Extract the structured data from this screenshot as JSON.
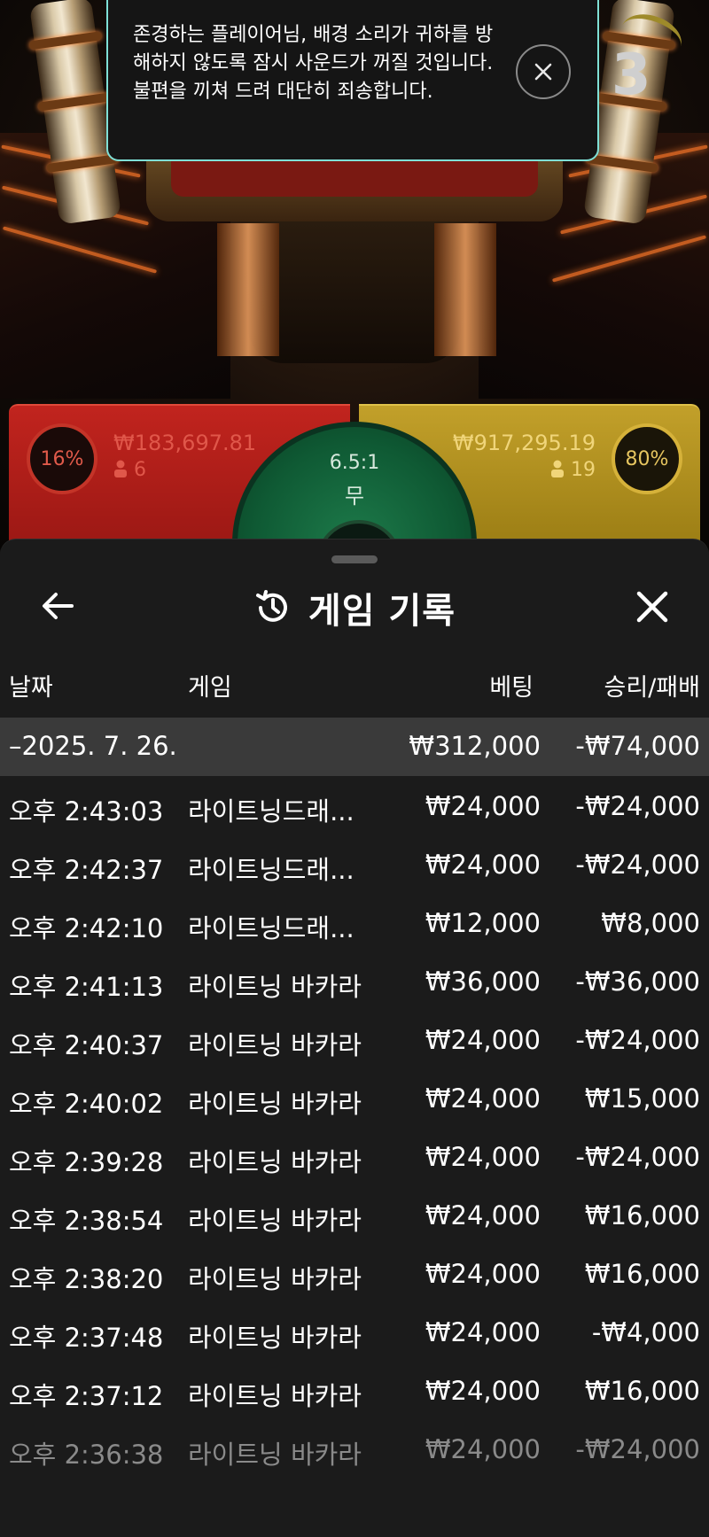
{
  "scene": {
    "countdown": "3"
  },
  "notice": {
    "text": "존경하는 플레이어님, 배경 소리가 귀하를 방해하지 않도록 잠시 사운드가 꺼질 것입니다. 불편을 끼쳐 드려 대단히 죄송합니다."
  },
  "bets": {
    "left": {
      "percent": "16%",
      "amount": "₩183,697.81",
      "players": "6"
    },
    "right": {
      "percent": "80%",
      "amount": "₩917,295.19",
      "players": "19"
    },
    "tie": {
      "odds": "6.5:1",
      "label": "무"
    }
  },
  "history": {
    "title": "게임 기록",
    "columns": {
      "date": "날짜",
      "game": "게임",
      "bet": "베팅",
      "result": "승리/패배"
    },
    "summary": {
      "date": "–2025. 7. 26.",
      "bet": "₩312,000",
      "result": "-₩74,000"
    },
    "rows": [
      {
        "time": "오후 2:43:03",
        "game": "라이트닝드래...",
        "bet": "₩24,000",
        "result": "-₩24,000"
      },
      {
        "time": "오후 2:42:37",
        "game": "라이트닝드래...",
        "bet": "₩24,000",
        "result": "-₩24,000"
      },
      {
        "time": "오후 2:42:10",
        "game": "라이트닝드래...",
        "bet": "₩12,000",
        "result": "₩8,000"
      },
      {
        "time": "오후 2:41:13",
        "game": "라이트닝 바카라",
        "bet": "₩36,000",
        "result": "-₩36,000"
      },
      {
        "time": "오후 2:40:37",
        "game": "라이트닝 바카라",
        "bet": "₩24,000",
        "result": "-₩24,000"
      },
      {
        "time": "오후 2:40:02",
        "game": "라이트닝 바카라",
        "bet": "₩24,000",
        "result": "₩15,000"
      },
      {
        "time": "오후 2:39:28",
        "game": "라이트닝 바카라",
        "bet": "₩24,000",
        "result": "-₩24,000"
      },
      {
        "time": "오후 2:38:54",
        "game": "라이트닝 바카라",
        "bet": "₩24,000",
        "result": "₩16,000"
      },
      {
        "time": "오후 2:38:20",
        "game": "라이트닝 바카라",
        "bet": "₩24,000",
        "result": "₩16,000"
      },
      {
        "time": "오후 2:37:48",
        "game": "라이트닝 바카라",
        "bet": "₩24,000",
        "result": "-₩4,000"
      },
      {
        "time": "오후 2:37:12",
        "game": "라이트닝 바카라",
        "bet": "₩24,000",
        "result": "₩16,000"
      },
      {
        "time": "오후 2:36:38",
        "game": "라이트닝 바카라",
        "bet": "₩24,000",
        "result": "-₩24,000"
      }
    ]
  }
}
